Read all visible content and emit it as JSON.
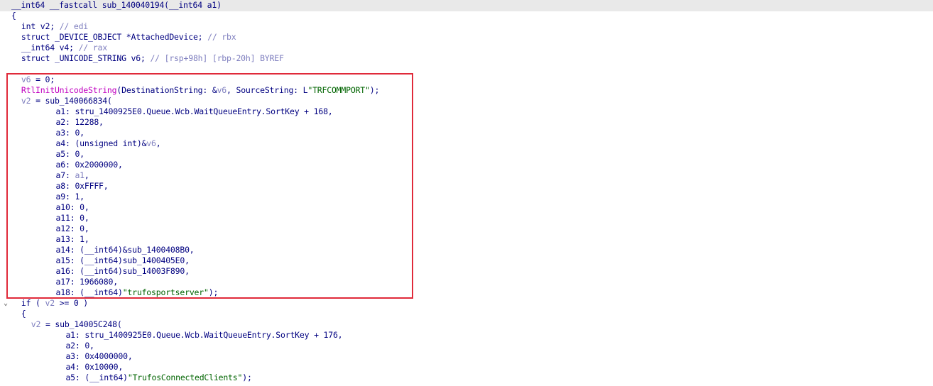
{
  "theme": {
    "header_bg": "#e9e9e9",
    "box_color": "#e02a3a",
    "text": "#000080",
    "comment": "#7f7fbf",
    "local_var": "#7f7fbf",
    "punct": "#000000",
    "string": "#006400",
    "function": "#c000c0"
  },
  "lines": [
    {
      "indent": 2,
      "tokens": [
        {
          "t": "__int64 __fastcall sub_140040194(__int64 a1)",
          "c": "text"
        }
      ]
    },
    {
      "indent": 2,
      "tokens": [
        {
          "t": "{",
          "c": "text"
        }
      ]
    },
    {
      "indent": 4,
      "tokens": [
        {
          "t": "int v2; ",
          "c": "text"
        },
        {
          "t": "// edi",
          "c": "comment"
        }
      ]
    },
    {
      "indent": 4,
      "tokens": [
        {
          "t": "struct _DEVICE_OBJECT *AttachedDevice; ",
          "c": "text"
        },
        {
          "t": "// rbx",
          "c": "comment"
        }
      ]
    },
    {
      "indent": 4,
      "tokens": [
        {
          "t": "__int64 v4; ",
          "c": "text"
        },
        {
          "t": "// rax",
          "c": "comment"
        }
      ]
    },
    {
      "indent": 4,
      "tokens": [
        {
          "t": "struct _UNICODE_STRING v6; ",
          "c": "text"
        },
        {
          "t": "// [rsp+98h] [rbp-20h] BYREF",
          "c": "comment"
        }
      ]
    },
    {
      "indent": 4,
      "tokens": []
    },
    {
      "indent": 4,
      "tokens": [
        {
          "t": "v6",
          "c": "local_var"
        },
        {
          "t": " = 0;",
          "c": "text"
        }
      ]
    },
    {
      "indent": 4,
      "tokens": [
        {
          "t": "RtlInitUnicodeString",
          "c": "function"
        },
        {
          "t": "(DestinationString: &",
          "c": "text"
        },
        {
          "t": "v6",
          "c": "local_var"
        },
        {
          "t": ", SourceString: L",
          "c": "text"
        },
        {
          "t": "\"TRFCOMMPORT\"",
          "c": "string"
        },
        {
          "t": ");",
          "c": "text"
        }
      ]
    },
    {
      "indent": 4,
      "tokens": [
        {
          "t": "v2",
          "c": "local_var"
        },
        {
          "t": " = sub_140066834(",
          "c": "text"
        }
      ]
    },
    {
      "indent": 11,
      "tokens": [
        {
          "t": "a1: stru_1400925E0.Queue.Wcb.WaitQueueEntry.SortKey + 168,",
          "c": "text"
        }
      ]
    },
    {
      "indent": 11,
      "tokens": [
        {
          "t": "a2: 12288,",
          "c": "text"
        }
      ]
    },
    {
      "indent": 11,
      "tokens": [
        {
          "t": "a3: 0,",
          "c": "text"
        }
      ]
    },
    {
      "indent": 11,
      "tokens": [
        {
          "t": "a4: (unsigned int)&",
          "c": "text"
        },
        {
          "t": "v6",
          "c": "local_var"
        },
        {
          "t": ",",
          "c": "text"
        }
      ]
    },
    {
      "indent": 11,
      "tokens": [
        {
          "t": "a5: 0,",
          "c": "text"
        }
      ]
    },
    {
      "indent": 11,
      "tokens": [
        {
          "t": "a6: 0x2000000,",
          "c": "text"
        }
      ]
    },
    {
      "indent": 11,
      "tokens": [
        {
          "t": "a7: ",
          "c": "text"
        },
        {
          "t": "a1",
          "c": "local_var"
        },
        {
          "t": ",",
          "c": "text"
        }
      ]
    },
    {
      "indent": 11,
      "tokens": [
        {
          "t": "a8: 0xFFFF,",
          "c": "text"
        }
      ]
    },
    {
      "indent": 11,
      "tokens": [
        {
          "t": "a9: 1,",
          "c": "text"
        }
      ]
    },
    {
      "indent": 11,
      "tokens": [
        {
          "t": "a10: 0,",
          "c": "text"
        }
      ]
    },
    {
      "indent": 11,
      "tokens": [
        {
          "t": "a11: 0,",
          "c": "text"
        }
      ]
    },
    {
      "indent": 11,
      "tokens": [
        {
          "t": "a12: 0,",
          "c": "text"
        }
      ]
    },
    {
      "indent": 11,
      "tokens": [
        {
          "t": "a13: 1,",
          "c": "text"
        }
      ]
    },
    {
      "indent": 11,
      "tokens": [
        {
          "t": "a14: (__int64)&sub_1400408B0,",
          "c": "text"
        }
      ]
    },
    {
      "indent": 11,
      "tokens": [
        {
          "t": "a15: (__int64)sub_1400405E0,",
          "c": "text"
        }
      ]
    },
    {
      "indent": 11,
      "tokens": [
        {
          "t": "a16: (__int64)sub_14003F890,",
          "c": "text"
        }
      ]
    },
    {
      "indent": 11,
      "tokens": [
        {
          "t": "a17: 1966080,",
          "c": "text"
        }
      ]
    },
    {
      "indent": 11,
      "tokens": [
        {
          "t": "a18: (__int64)",
          "c": "text"
        },
        {
          "t": "\"trufosportserver\"",
          "c": "string"
        },
        {
          "t": ");",
          "c": "text"
        }
      ]
    },
    {
      "indent": 4,
      "fold": "⌄",
      "tokens": [
        {
          "t": "if ( ",
          "c": "text"
        },
        {
          "t": "v2",
          "c": "local_var"
        },
        {
          "t": " >= 0 )",
          "c": "text"
        }
      ]
    },
    {
      "indent": 4,
      "tokens": [
        {
          "t": "{",
          "c": "text"
        }
      ]
    },
    {
      "indent": 6,
      "tokens": [
        {
          "t": "v2",
          "c": "local_var"
        },
        {
          "t": " = sub_14005C248(",
          "c": "text"
        }
      ]
    },
    {
      "indent": 13,
      "tokens": [
        {
          "t": "a1: stru_1400925E0.Queue.Wcb.WaitQueueEntry.SortKey + 176,",
          "c": "text"
        }
      ]
    },
    {
      "indent": 13,
      "tokens": [
        {
          "t": "a2: 0,",
          "c": "text"
        }
      ]
    },
    {
      "indent": 13,
      "tokens": [
        {
          "t": "a3: 0x4000000,",
          "c": "text"
        }
      ]
    },
    {
      "indent": 13,
      "tokens": [
        {
          "t": "a4: 0x10000,",
          "c": "text"
        }
      ]
    },
    {
      "indent": 13,
      "tokens": [
        {
          "t": "a5: (__int64)",
          "c": "text"
        },
        {
          "t": "\"TrufosConnectedClients\"",
          "c": "string"
        },
        {
          "t": ");",
          "c": "text"
        }
      ]
    }
  ]
}
